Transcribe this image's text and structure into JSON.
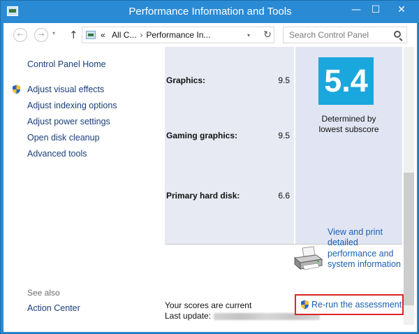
{
  "window": {
    "title": "Performance Information and Tools",
    "controls": {
      "minimize": "—",
      "maximize": "☐",
      "close": "✕"
    }
  },
  "navigation": {
    "back": "←",
    "forward": "→",
    "up": "↑",
    "address": {
      "prefix": "«",
      "crumb1": "All C...",
      "crumb2": "Performance In...",
      "dropdown": "▾",
      "refresh": "↻"
    },
    "search_placeholder": "Search Control Panel"
  },
  "left_pane": {
    "home": "Control Panel Home",
    "tasks": [
      {
        "label": "Adjust visual effects",
        "shield": true
      },
      {
        "label": "Adjust indexing options",
        "shield": false
      },
      {
        "label": "Adjust power settings",
        "shield": false
      },
      {
        "label": "Open disk cleanup",
        "shield": false
      },
      {
        "label": "Advanced tools",
        "shield": false
      }
    ],
    "see_also": "See also",
    "see_also_links": [
      "Action Center"
    ]
  },
  "scores": {
    "rows": [
      {
        "component": "Graphics:",
        "subscore": "9.5"
      },
      {
        "component": "Gaming graphics:",
        "subscore": "9.5"
      },
      {
        "component": "Primary hard disk:",
        "subscore": "6.6"
      }
    ],
    "base_score": "5.4",
    "base_score_note_line1": "Determined by",
    "base_score_note_line2": "lowest subscore",
    "tile_color": "#1aa7dd"
  },
  "actions": {
    "view_print_link": "View and print detailed performance and system information",
    "scores_status": "Your scores are current",
    "last_update_label": "Last update:",
    "rerun_link": "Re-run the assessment"
  },
  "colors": {
    "titlebar": "#2a8ad4",
    "link": "#1a5fb4",
    "highlight": "#d9262a"
  }
}
